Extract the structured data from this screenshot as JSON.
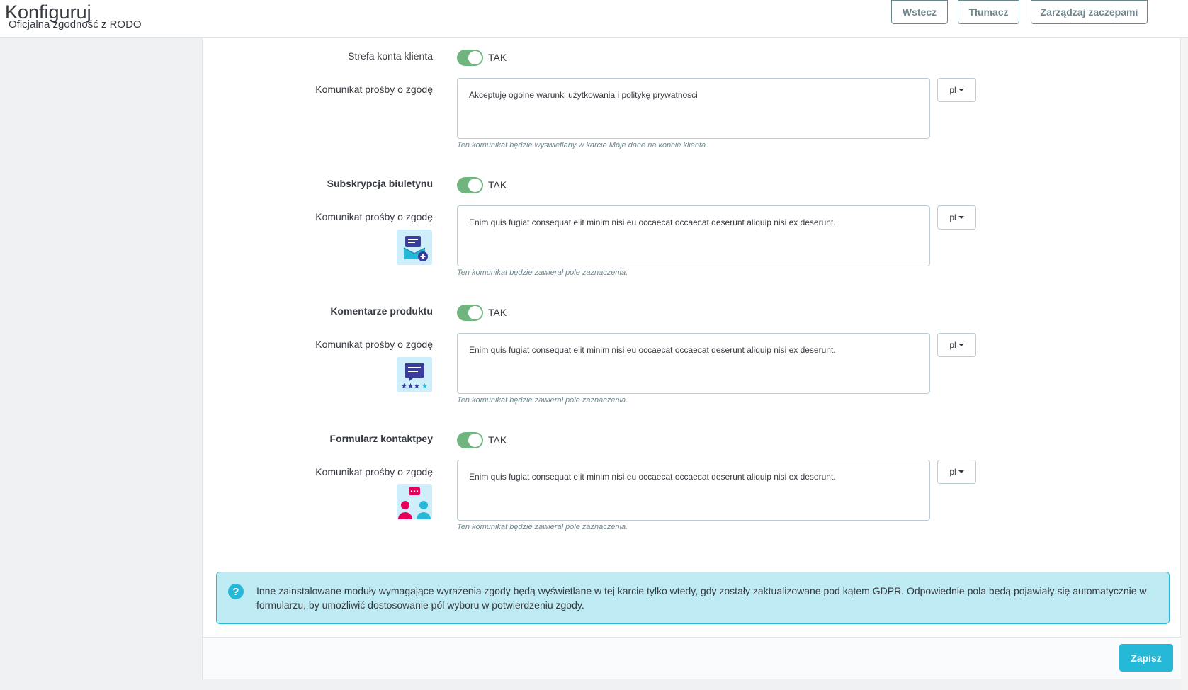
{
  "header": {
    "title": "Konfiguruj",
    "subtitle": "Oficjalna zgodność z RODO",
    "buttons": {
      "back": "Wstecz",
      "translate": "Tłumacz",
      "manage_hooks": "Zarządzaj zaczepami"
    }
  },
  "sections": [
    {
      "label": "Strefa konta klienta",
      "toggle": "TAK",
      "message_label": "Komunikat prośby o zgodę",
      "message": "Akceptuję ogolne warunki użytkowania i politykę prywatnosci",
      "lang": "pl",
      "help": "Ten komunikat będzie wyswietlany w karcie Moje dane na koncie klienta"
    },
    {
      "label": "Subskrypcja biuletynu",
      "toggle": "TAK",
      "message_label": "Komunikat prośby o zgodę",
      "message": "Enim quis fugiat consequat elit minim nisi eu occaecat occaecat deserunt aliquip nisi ex deserunt.",
      "lang": "pl",
      "help": "Ten komunikat będzie zawierał pole zaznaczenia.",
      "icon": "newsletter-icon"
    },
    {
      "label": "Komentarze produktu",
      "toggle": "TAK",
      "message_label": "Komunikat prośby o zgodę",
      "message": "Enim quis fugiat consequat elit minim nisi eu occaecat occaecat deserunt aliquip nisi ex deserunt.",
      "lang": "pl",
      "help": "Ten komunikat będzie zawierał pole zaznaczenia.",
      "icon": "product-comments-icon"
    },
    {
      "label": "Formularz kontaktpey",
      "toggle": "TAK",
      "message_label": "Komunikat prośby o zgodę",
      "message": "Enim quis fugiat consequat elit minim nisi eu occaecat occaecat deserunt aliquip nisi ex deserunt.",
      "lang": "pl",
      "help": "Ten komunikat będzie zawierał pole zaznaczenia.",
      "icon": "contact-form-icon"
    }
  ],
  "alert": {
    "icon": "question-icon",
    "text": "Inne zainstalowane moduły wymagające wyrażenia zgody będą wyświetlane w tej karcie tylko wtedy, gdy zostały zaktualizowane pod kątem GDPR. Odpowiednie pola będą pojawiały się automatycznie w formularzu, by umożliwić dostosowanie pól wyboru w potwierdzeniu zgody."
  },
  "footer": {
    "save_label": "Zapisz"
  },
  "colors": {
    "accent": "#25b9d7",
    "switch_on": "#70b580",
    "alert_bg": "#beeaf3"
  }
}
